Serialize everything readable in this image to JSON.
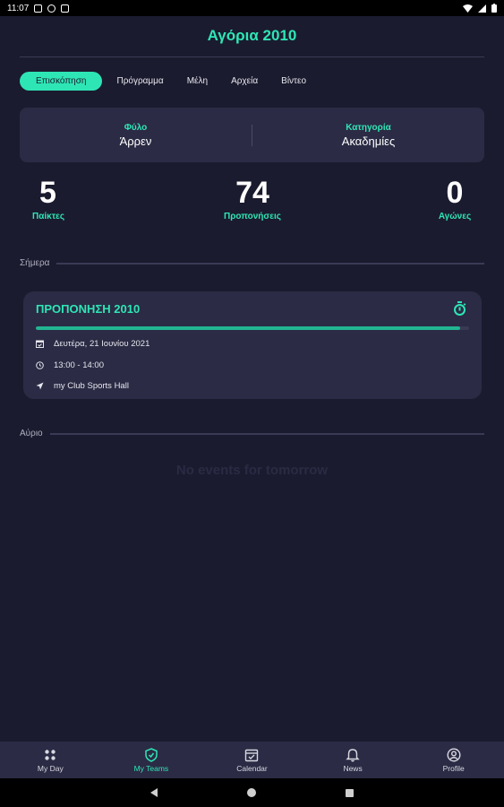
{
  "status_bar": {
    "time": "11:07"
  },
  "header": {
    "title": "Αγόρια 2010"
  },
  "tabs": [
    {
      "label": "Επισκόπηση",
      "active": true
    },
    {
      "label": "Πρόγραμμα",
      "active": false
    },
    {
      "label": "Μέλη",
      "active": false
    },
    {
      "label": "Αρχεία",
      "active": false
    },
    {
      "label": "Βίντεο",
      "active": false
    }
  ],
  "info": {
    "gender_label": "Φύλο",
    "gender_value": "Άρρεν",
    "category_label": "Κατηγορία",
    "category_value": "Ακαδημίες"
  },
  "stats": {
    "players": {
      "value": "5",
      "label": "Παίκτες"
    },
    "trainings": {
      "value": "74",
      "label": "Προπονήσεις"
    },
    "matches": {
      "value": "0",
      "label": "Αγώνες"
    }
  },
  "today": {
    "heading": "Σήμερα",
    "event": {
      "title": "ΠΡΟΠΟΝΗΣΗ 2010",
      "progress": 0.98,
      "date": "Δευτέρα, 21 Ιουνίου 2021",
      "time": "13:00 - 14:00",
      "location": "my Club Sports Hall",
      "icon": "stopwatch-icon"
    }
  },
  "tomorrow": {
    "heading": "Αύριο",
    "empty_text": "No events for tomorrow"
  },
  "bottom_nav": [
    {
      "label": "My Day",
      "icon": "grid-icon",
      "active": false
    },
    {
      "label": "My Teams",
      "icon": "shield-icon",
      "active": true
    },
    {
      "label": "Calendar",
      "icon": "calendar-icon",
      "active": false
    },
    {
      "label": "News",
      "icon": "bell-icon",
      "active": false
    },
    {
      "label": "Profile",
      "icon": "profile-icon",
      "active": false
    }
  ],
  "colors": {
    "accent": "#2ee6b5",
    "background": "#1b1b2f",
    "card": "#2b2b45"
  }
}
